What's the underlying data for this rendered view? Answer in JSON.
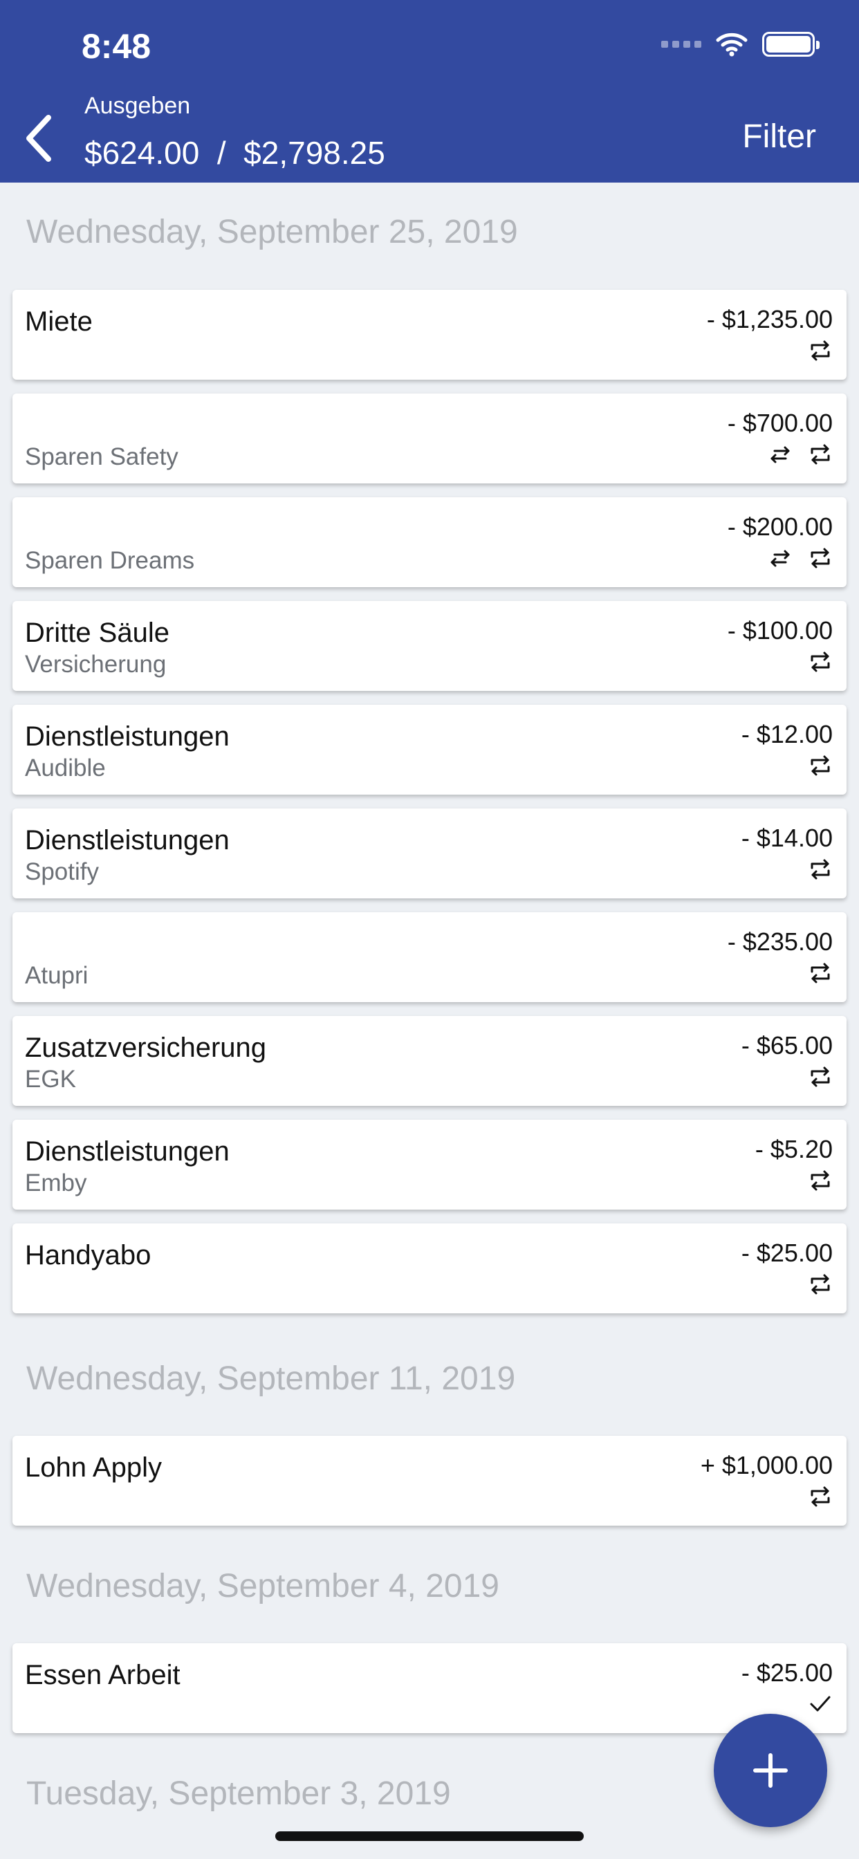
{
  "status_bar": {
    "time": "8:48"
  },
  "header": {
    "subtitle": "Ausgeben",
    "totals": "$624.00  /  $2,798.25",
    "filter_label": "Filter"
  },
  "sections": [
    {
      "date": "Wednesday, September 25, 2019",
      "items": [
        {
          "title": "Miete",
          "subtitle": "",
          "amount": "- $1,235.00",
          "icons": [
            "repeat-icon"
          ]
        },
        {
          "title": "",
          "subtitle": "Sparen Safety",
          "amount": "- $700.00",
          "icons": [
            "transfer-icon",
            "repeat-icon"
          ]
        },
        {
          "title": "",
          "subtitle": "Sparen Dreams",
          "amount": "- $200.00",
          "icons": [
            "transfer-icon",
            "repeat-icon"
          ]
        },
        {
          "title": "Dritte Säule",
          "subtitle": "Versicherung",
          "amount": "- $100.00",
          "icons": [
            "repeat-icon"
          ]
        },
        {
          "title": "Dienstleistungen",
          "subtitle": "Audible",
          "amount": "- $12.00",
          "icons": [
            "repeat-icon"
          ]
        },
        {
          "title": "Dienstleistungen",
          "subtitle": "Spotify",
          "amount": "- $14.00",
          "icons": [
            "repeat-icon"
          ]
        },
        {
          "title": "",
          "subtitle": "Atupri",
          "amount": "- $235.00",
          "icons": [
            "repeat-icon"
          ]
        },
        {
          "title": "Zusatzversicherung",
          "subtitle": "EGK",
          "amount": "- $65.00",
          "icons": [
            "repeat-icon"
          ]
        },
        {
          "title": "Dienstleistungen",
          "subtitle": "Emby",
          "amount": "- $5.20",
          "icons": [
            "repeat-icon"
          ]
        },
        {
          "title": "Handyabo",
          "subtitle": "",
          "amount": "- $25.00",
          "icons": [
            "repeat-icon"
          ]
        }
      ]
    },
    {
      "date": "Wednesday, September 11, 2019",
      "items": [
        {
          "title": "Lohn Apply",
          "subtitle": "",
          "amount": "+ $1,000.00",
          "icons": [
            "repeat-icon"
          ]
        }
      ]
    },
    {
      "date": "Wednesday, September 4, 2019",
      "items": [
        {
          "title": "Essen Arbeit",
          "subtitle": "",
          "amount": "- $25.00",
          "icons": [
            "check-icon"
          ]
        }
      ]
    },
    {
      "date": "Tuesday, September 3, 2019",
      "items": []
    }
  ],
  "colors": {
    "primary": "#334aa0",
    "background": "#edf0f4",
    "date_text": "#b3b6bb",
    "subtitle_text": "#6c7076"
  },
  "fab": {
    "icon": "plus-icon"
  }
}
